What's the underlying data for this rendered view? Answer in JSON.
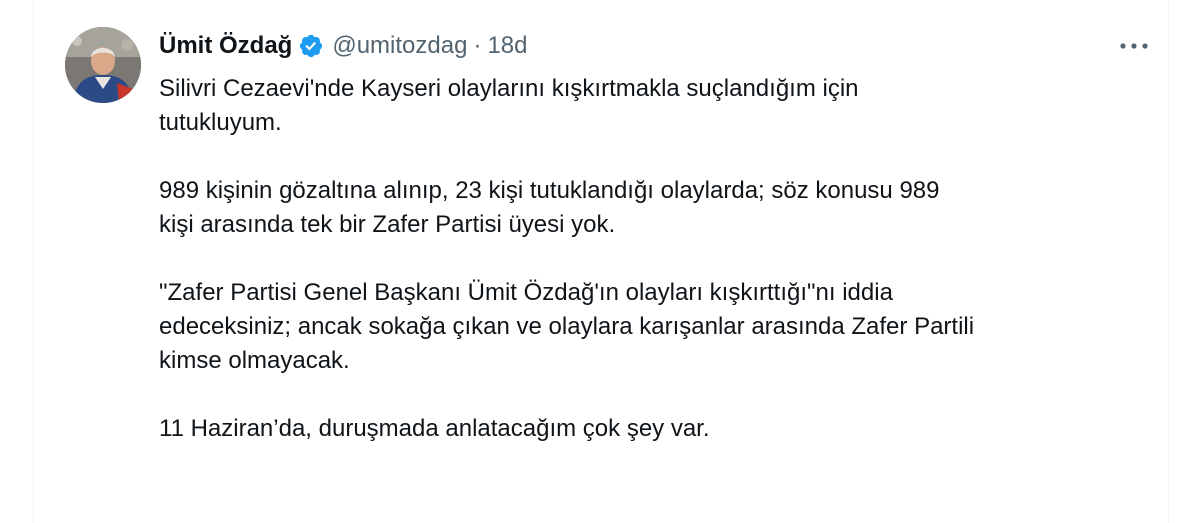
{
  "author": {
    "name": "Ümit Özdağ",
    "handle": "@umitozdag",
    "separator": "·",
    "time": "18d",
    "verified": true
  },
  "icons": {
    "verified": "verified-badge-icon",
    "more": "more-horizontal-icon",
    "avatar": "profile-photo"
  },
  "colors": {
    "verified": "#1d9bf0",
    "text": "#0f1419",
    "muted": "#536471"
  },
  "tweet": {
    "line1": "Silivri Cezaevi'nde Kayseri olaylarını kışkırtmakla suçlandığım için",
    "line2": "tutukluyum.",
    "line3": "989 kişinin gözaltına alınıp, 23 kişi tutuklandığı olaylarda; söz konusu 989",
    "line4": "kişi arasında tek bir Zafer Partisi üyesi yok.",
    "line5": "\"Zafer Partisi Genel Başkanı Ümit Özdağ'ın olayları kışkırttığı\"nı iddia",
    "line6": "edeceksiniz; ancak sokağa çıkan ve olaylara karışanlar arasında Zafer Partili",
    "line7": "kimse olmayacak.",
    "line8": "11 Haziran’da, duruşmada anlatacağım çok şey var."
  }
}
